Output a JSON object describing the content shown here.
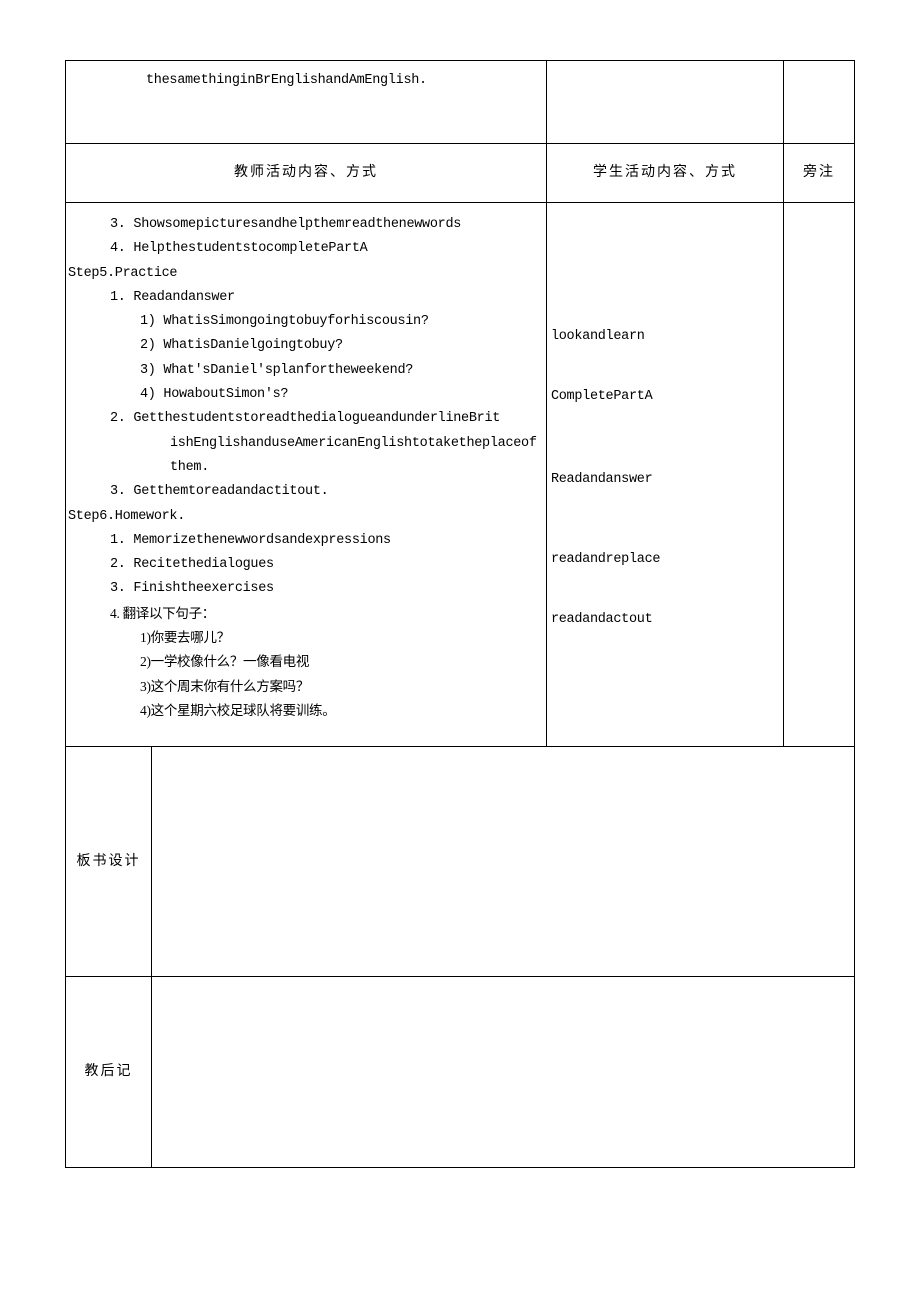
{
  "row1_text": "thesamethinginBrEnglishandAmEnglish.",
  "headers": {
    "teacher": "教师活动内容、方式",
    "student": "学生活动内容、方式",
    "notes": "旁注"
  },
  "teacher": {
    "item3": "3.  Showsomepicturesandhelpthemreadthenewwords",
    "item4": "4.  HelpthestudentstocompletePartA",
    "step5": "Step5.Practice",
    "s5_1": "1.  Readandanswer",
    "s5_1_1": "1)  WhatisSimongoingtobuyforhiscousin?",
    "s5_1_2": "2)  WhatisDanielgoingtobuy?",
    "s5_1_3": "3)  What'sDaniel'splanfortheweekend?",
    "s5_1_4": "4)  HowaboutSimon's?",
    "s5_2a": "2.  GetthestudentstoreadthedialogueandunderlineBrit",
    "s5_2b": "ishEnglishanduseAmericanEnglishtotaketheplaceof",
    "s5_2c": "them.",
    "s5_3": "3.  Getthemtoreadandactitout.",
    "step6": "Step6.Homework.",
    "s6_1": "1.  Memorizethenewwordsandexpressions",
    "s6_2": "2.  Recitethedialogues",
    "s6_3": "3.  Finishtheexercises",
    "s6_4": "4.  翻译以下句子：",
    "s6_4_1": "1)你要去哪儿？",
    "s6_4_2": "2)一学校像什么？一像看电视",
    "s6_4_3": "3)这个周末你有什么方案吗？",
    "s6_4_4": "4)这个星期六校足球队将要训练。"
  },
  "student": {
    "s1": "lookandlearn",
    "s2": "CompletePartA",
    "s3": "Readandanswer",
    "s4": "readandreplace",
    "s5": "readandactout"
  },
  "labels": {
    "board": "板书设计",
    "after": "教后记"
  }
}
